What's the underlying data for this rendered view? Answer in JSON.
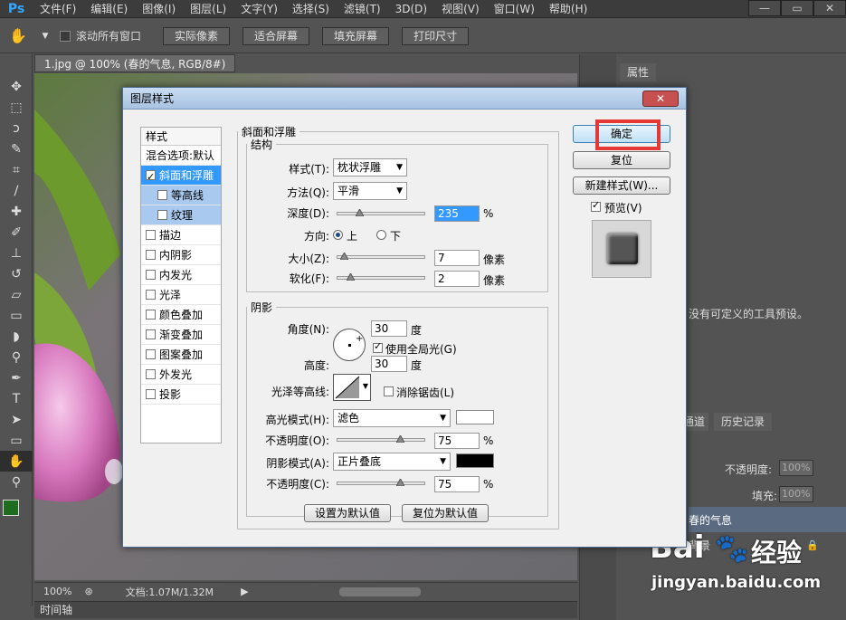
{
  "app": {
    "logo": "Ps",
    "menu": [
      "文件(F)",
      "编辑(E)",
      "图像(I)",
      "图层(L)",
      "文字(Y)",
      "选择(S)",
      "滤镜(T)",
      "3D(D)",
      "视图(V)",
      "窗口(W)",
      "帮助(H)"
    ],
    "window_controls": [
      "—",
      "▭",
      "✕"
    ]
  },
  "options_bar": {
    "scroll_all_label": "滚动所有窗口",
    "buttons": [
      "实际像素",
      "适合屏幕",
      "填充屏幕",
      "打印尺寸"
    ]
  },
  "document": {
    "tab_title": "1.jpg @ 100% (春的气息, RGB/8#) *",
    "zoom": "100%",
    "doc_size": "文档:1.07M/1.32M",
    "timeline_label": "时间轴"
  },
  "right_panel": {
    "properties_tab": "属性",
    "tool_presets_text": "没有可定义的工具预设。",
    "channels_tab": "通道",
    "history_tab": "历史记录",
    "opacity_label": "不透明度:",
    "opacity_value": "100%",
    "fill_label": "填充:",
    "fill_value": "100%",
    "layer_name": "春的气息",
    "bg_layer_name": "背景"
  },
  "dialog": {
    "title": "图层样式",
    "close": "✕",
    "styles_header": "样式",
    "blend_options": "混合选项:默认",
    "styles": [
      {
        "label": "斜面和浮雕",
        "checked": true,
        "selected": true,
        "sub": false
      },
      {
        "label": "等高线",
        "checked": false,
        "selected": false,
        "sub": true
      },
      {
        "label": "纹理",
        "checked": false,
        "selected": false,
        "sub": true
      },
      {
        "label": "描边",
        "checked": false,
        "selected": false,
        "sub": false
      },
      {
        "label": "内阴影",
        "checked": false,
        "selected": false,
        "sub": false
      },
      {
        "label": "内发光",
        "checked": false,
        "selected": false,
        "sub": false
      },
      {
        "label": "光泽",
        "checked": false,
        "selected": false,
        "sub": false
      },
      {
        "label": "颜色叠加",
        "checked": false,
        "selected": false,
        "sub": false
      },
      {
        "label": "渐变叠加",
        "checked": false,
        "selected": false,
        "sub": false
      },
      {
        "label": "图案叠加",
        "checked": false,
        "selected": false,
        "sub": false
      },
      {
        "label": "外发光",
        "checked": false,
        "selected": false,
        "sub": false
      },
      {
        "label": "投影",
        "checked": false,
        "selected": false,
        "sub": false
      }
    ],
    "bevel_section": "斜面和浮雕",
    "structure_section": "结构",
    "style_label": "样式(T):",
    "style_value": "枕状浮雕",
    "technique_label": "方法(Q):",
    "technique_value": "平滑",
    "depth_label": "深度(D):",
    "depth_value": "235",
    "depth_fraction": 0.235,
    "percent": "%",
    "direction_label": "方向:",
    "direction_up": "上",
    "direction_down": "下",
    "size_label": "大小(Z):",
    "size_value": "7",
    "size_fraction": 0.03,
    "soften_label": "软化(F):",
    "soften_value": "2",
    "soften_fraction": 0.12,
    "pixels": "像素",
    "shading_section": "阴影",
    "angle_label": "角度(N):",
    "angle_value": "30",
    "degree": "度",
    "global_light_label": "使用全局光(G)",
    "altitude_label": "高度:",
    "altitude_value": "30",
    "gloss_contour_label": "光泽等高线:",
    "anti_alias_label": "消除锯齿(L)",
    "highlight_mode_label": "高光模式(H):",
    "highlight_mode_value": "滤色",
    "highlight_color": "#ffffff",
    "highlight_opacity_label": "不透明度(O):",
    "highlight_opacity_value": "75",
    "highlight_opacity_fraction": 0.75,
    "shadow_mode_label": "阴影模式(A):",
    "shadow_mode_value": "正片叠底",
    "shadow_color": "#000000",
    "shadow_opacity_label": "不透明度(C):",
    "shadow_opacity_value": "75",
    "shadow_opacity_fraction": 0.75,
    "make_default": "设置为默认值",
    "reset_default": "复位为默认值",
    "ok": "确定",
    "reset": "复位",
    "new_style": "新建样式(W)...",
    "preview_label": "预览(V)",
    "highlight_box_color": "#e53935"
  },
  "watermark": {
    "brand": "Bai",
    "brand_suffix": "经验",
    "url": "jingyan.baidu.com"
  }
}
